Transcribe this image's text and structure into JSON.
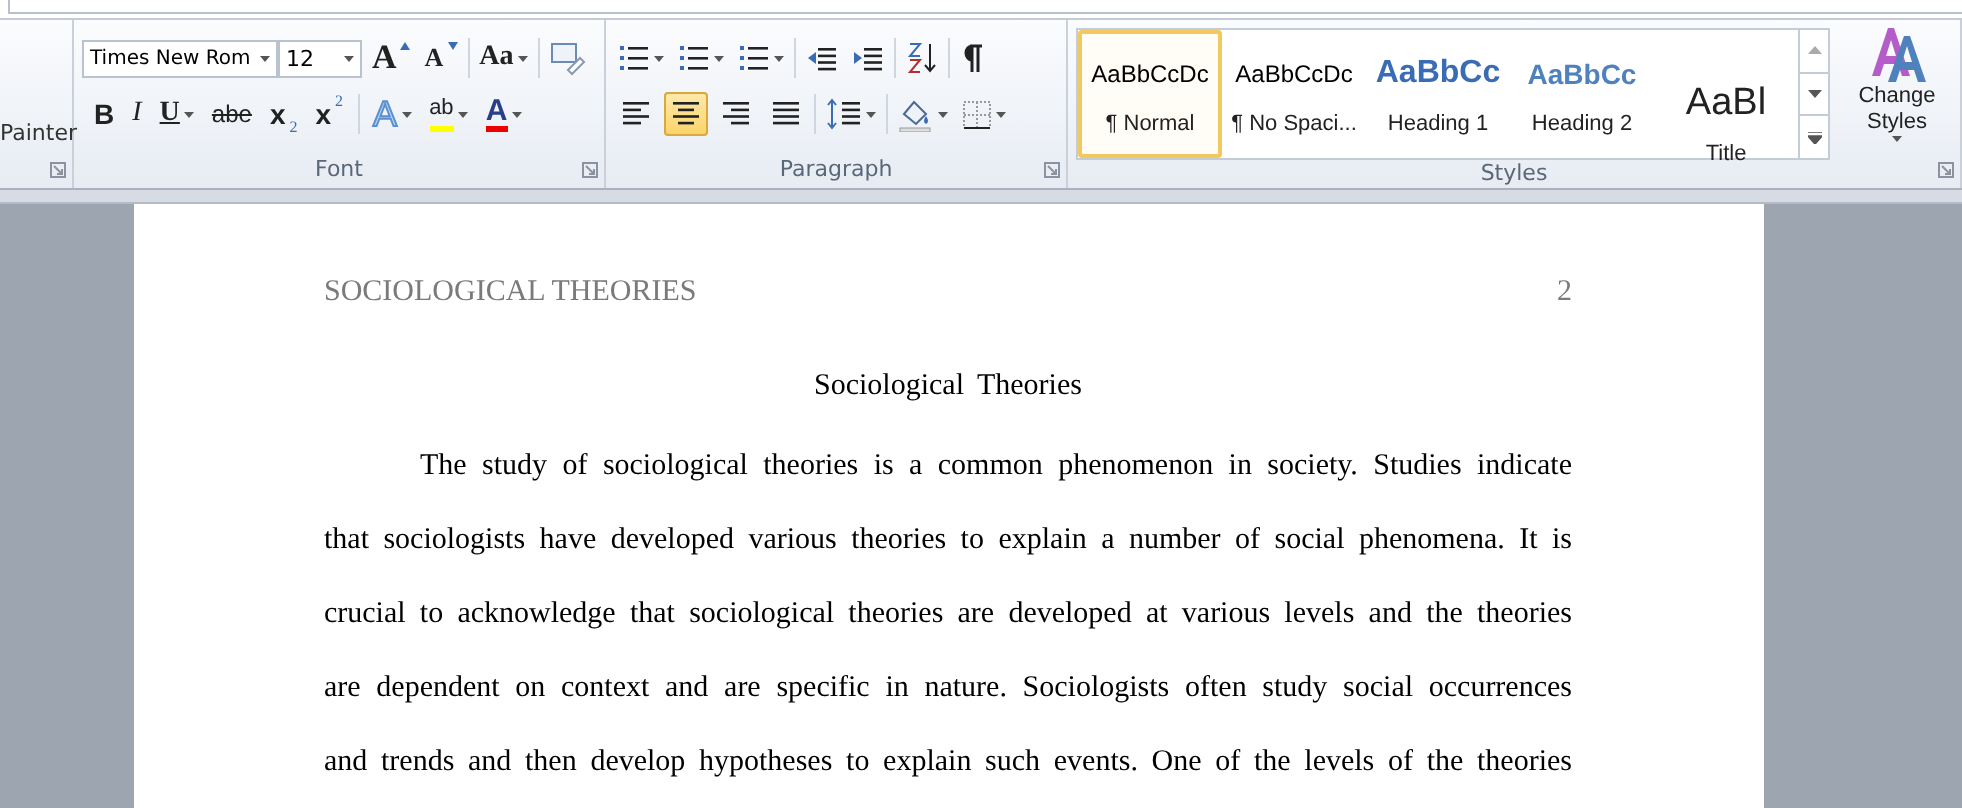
{
  "clipboard": {
    "label": "Painter"
  },
  "font_group": {
    "label": "Font",
    "font_name": "Times New Rom",
    "font_size": "12",
    "row1": [
      {
        "kind": "grow",
        "label": "A"
      },
      {
        "kind": "shrink",
        "label": "A"
      },
      {
        "kind": "case",
        "label": "Aa"
      },
      {
        "kind": "clear"
      }
    ],
    "row2": [
      {
        "kind": "bold",
        "label": "B"
      },
      {
        "kind": "italic",
        "label": "I"
      },
      {
        "kind": "underline",
        "label": "U"
      },
      {
        "kind": "strike",
        "label": "abe"
      },
      {
        "kind": "sub",
        "label": "x",
        "script": "2"
      },
      {
        "kind": "sup",
        "label": "x",
        "script": "2"
      },
      {
        "kind": "effects",
        "label": "A"
      },
      {
        "kind": "highlight",
        "label": "ab"
      },
      {
        "kind": "color",
        "label": "A"
      }
    ]
  },
  "paragraph_group": {
    "label": "Paragraph",
    "alignments": [
      {
        "kind": "left",
        "selected": false
      },
      {
        "kind": "center",
        "selected": true
      },
      {
        "kind": "right",
        "selected": false
      },
      {
        "kind": "justify",
        "selected": false
      }
    ]
  },
  "styles_group": {
    "label": "Styles",
    "styles": [
      {
        "kind": "normal",
        "preview": "AaBbCcDc",
        "name": "¶ Normal",
        "selected": true
      },
      {
        "kind": "normal",
        "preview": "AaBbCcDc",
        "name": "¶ No Spaci...",
        "selected": false
      },
      {
        "kind": "heading1",
        "preview": "AaBbCc",
        "name": "Heading 1",
        "selected": false
      },
      {
        "kind": "heading2",
        "preview": "AaBbCc",
        "name": "Heading 2",
        "selected": false
      },
      {
        "kind": "title",
        "preview": "AaBl",
        "name": "Title",
        "selected": false
      }
    ],
    "change_styles": "Change Styles"
  },
  "document": {
    "header": "SOCIOLOGICAL THEORIES",
    "page_number": "2",
    "title": "Sociological Theories",
    "lines": [
      "The study of sociological theories is a common phenomenon in society. Studies indicate",
      "that sociologists have developed various theories to explain a number of social phenomena. It is",
      "crucial to acknowledge that sociological theories are developed at various levels and the theories",
      "are dependent on context and are specific in nature. Sociologists often study social occurrences",
      "and trends and then develop hypotheses to explain such events. One of the levels of the theories"
    ]
  }
}
